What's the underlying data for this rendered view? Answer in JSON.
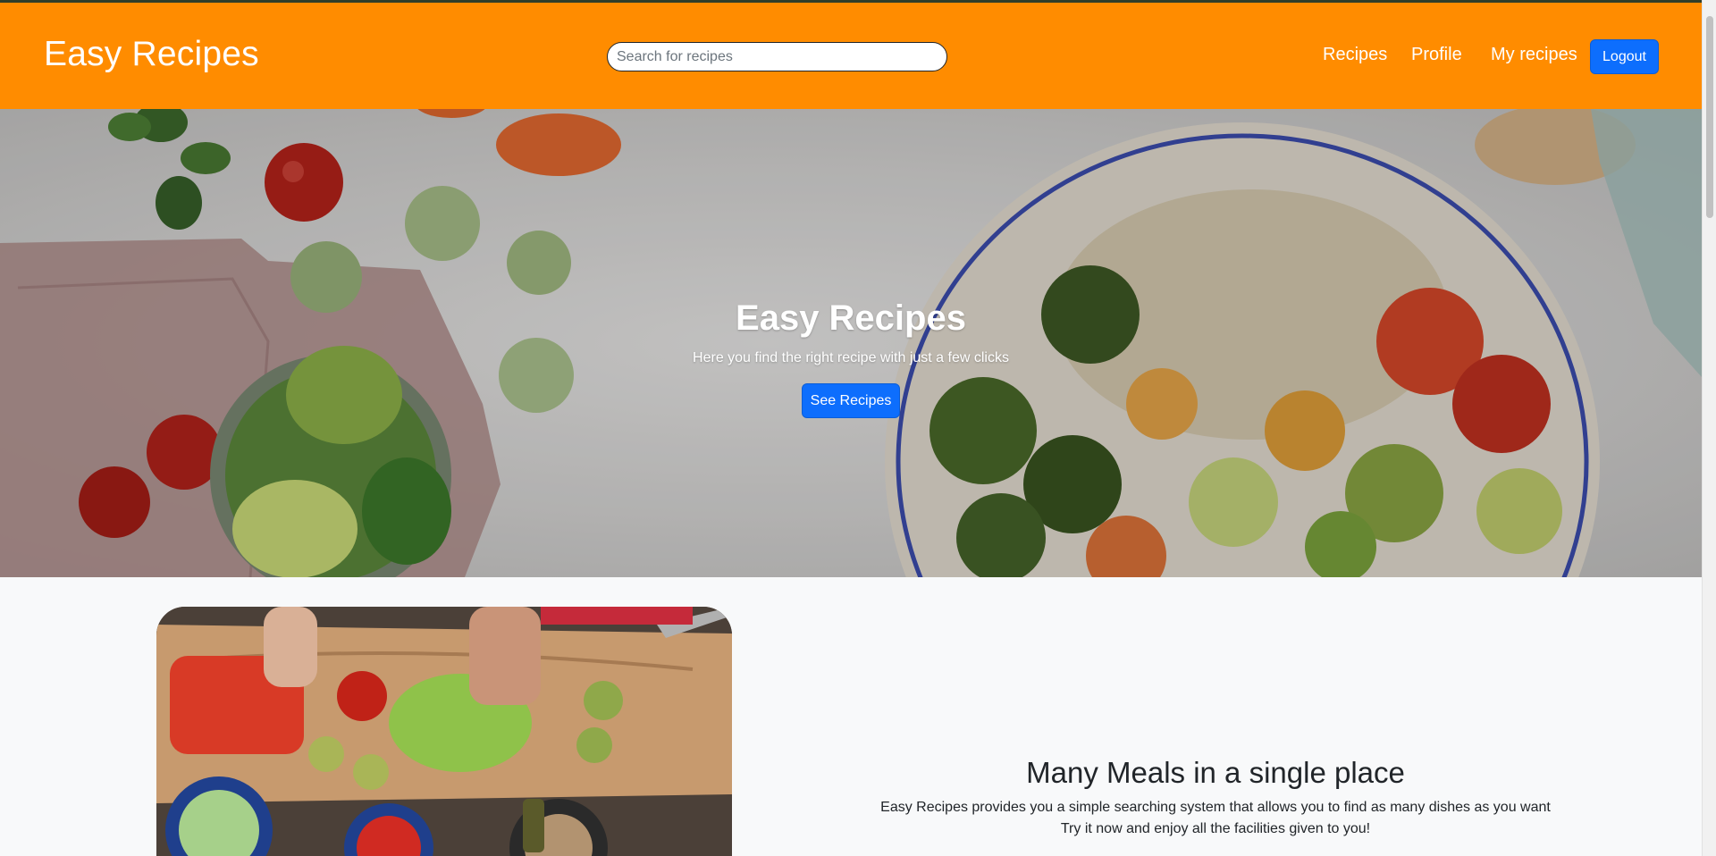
{
  "header": {
    "brand": "Easy Recipes",
    "search_placeholder": "Search for recipes",
    "nav": {
      "recipes": "Recipes",
      "profile": "Profile",
      "my_recipes": "My recipes"
    },
    "logout_label": "Logout"
  },
  "hero": {
    "title": "Easy Recipes",
    "subtitle": "Here you find the right recipe with just a few clicks",
    "button_label": "See Recipes"
  },
  "feature": {
    "title": "Many Meals in a single place",
    "line1": "Easy Recipes provides you a simple searching system that allows you to find as many dishes as you want",
    "line2": "Try it now and enjoy all the facilities given to you!"
  },
  "colors": {
    "navbar": "#ff8c00",
    "primary_button": "#0d6efd",
    "page_background": "#f8f9fa"
  }
}
